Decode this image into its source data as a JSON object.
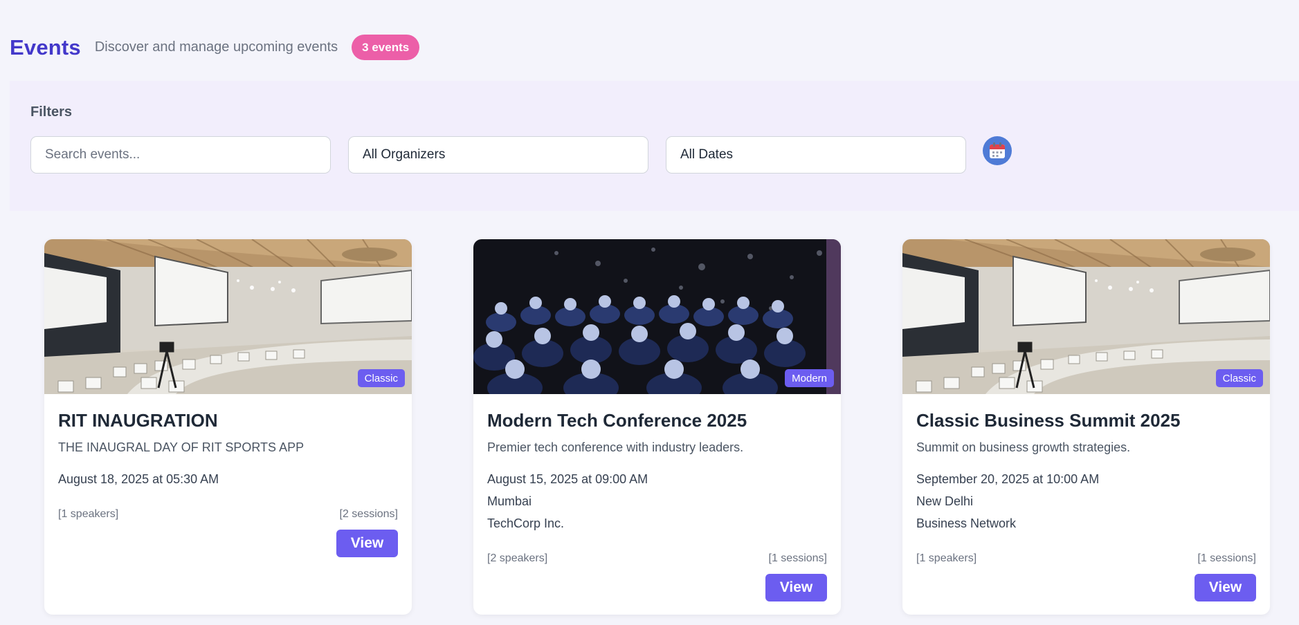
{
  "header": {
    "title": "Events",
    "subtitle": "Discover and manage upcoming events",
    "count_badge": "3 events"
  },
  "filters": {
    "label": "Filters",
    "search_placeholder": "Search events...",
    "organizer_selected": "All Organizers",
    "date_selected": "All Dates",
    "calendar_icon": "calendar-icon"
  },
  "events": [
    {
      "title": "RIT INAUGRATION",
      "description": "THE INAUGRAL DAY OF RIT SPORTS APP",
      "datetime": "August 18, 2025 at 05:30 AM",
      "speakers": "[1 speakers]",
      "sessions": "[2 sessions]",
      "style": "Classic",
      "view_label": "View"
    },
    {
      "title": "Modern Tech Conference 2025",
      "description": "Premier tech conference with industry leaders.",
      "datetime": "August 15, 2025 at 09:00 AM",
      "location": "Mumbai",
      "organizer": "TechCorp Inc.",
      "speakers": "[2 speakers]",
      "sessions": "[1 sessions]",
      "style": "Modern",
      "view_label": "View"
    },
    {
      "title": "Classic Business Summit 2025",
      "description": "Summit on business growth strategies.",
      "datetime": "September 20, 2025 at 10:00 AM",
      "location": "New Delhi",
      "organizer": "Business Network",
      "speakers": "[1 speakers]",
      "sessions": "[1 sessions]",
      "style": "Classic",
      "view_label": "View"
    }
  ],
  "colors": {
    "title": "#4338ca",
    "badge_pink": "#ec5fa8",
    "accent": "#6c5df0",
    "filter_panel": "#f2eefc",
    "background": "#f4f4fb"
  }
}
